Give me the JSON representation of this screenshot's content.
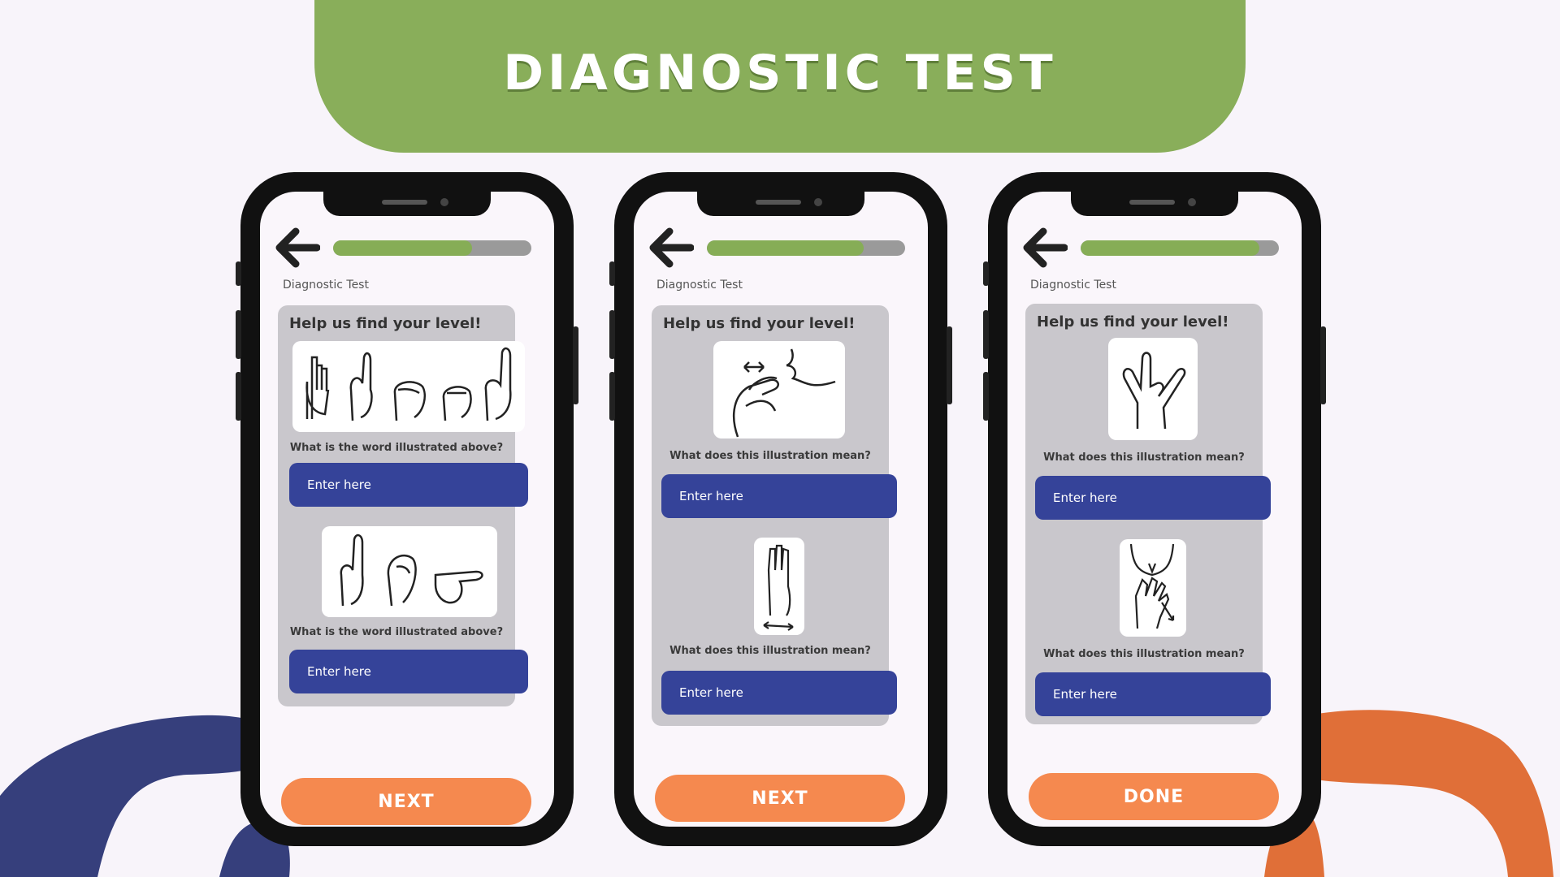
{
  "banner": {
    "title": "DIAGNOSTIC TEST"
  },
  "colors": {
    "banner": "#89ae5a",
    "input": "#354399",
    "button": "#f5894f",
    "blob_left": "#363f7c",
    "blob_right": "#e06f38"
  },
  "screens": [
    {
      "progress": 0.7,
      "breadcrumb": "Diagnostic Test",
      "card_title": "Help us find your level!",
      "questions": [
        {
          "prompt": "What is the word illustrated above?",
          "placeholder": "Enter here",
          "illustration": "hand-signs-five-letters"
        },
        {
          "prompt": "What is the word illustrated above?",
          "placeholder": "Enter here",
          "illustration": "hand-signs-three-letters"
        }
      ],
      "action_label": "NEXT"
    },
    {
      "progress": 0.79,
      "breadcrumb": "Diagnostic Test",
      "card_title": "Help us find your level!",
      "questions": [
        {
          "prompt": "What does this illustration mean?",
          "placeholder": "Enter here",
          "illustration": "hand-at-chin-sign"
        },
        {
          "prompt": "What does this illustration mean?",
          "placeholder": "Enter here",
          "illustration": "raised-hand-sign"
        }
      ],
      "action_label": "NEXT"
    },
    {
      "progress": 0.9,
      "breadcrumb": "Diagnostic Test",
      "card_title": "Help us find your level!",
      "questions": [
        {
          "prompt": "What does this illustration mean?",
          "placeholder": "Enter here",
          "illustration": "i-love-you-sign"
        },
        {
          "prompt": "What does this illustration mean?",
          "placeholder": "Enter here",
          "illustration": "hand-on-chest-sign"
        }
      ],
      "action_label": "DONE"
    }
  ]
}
